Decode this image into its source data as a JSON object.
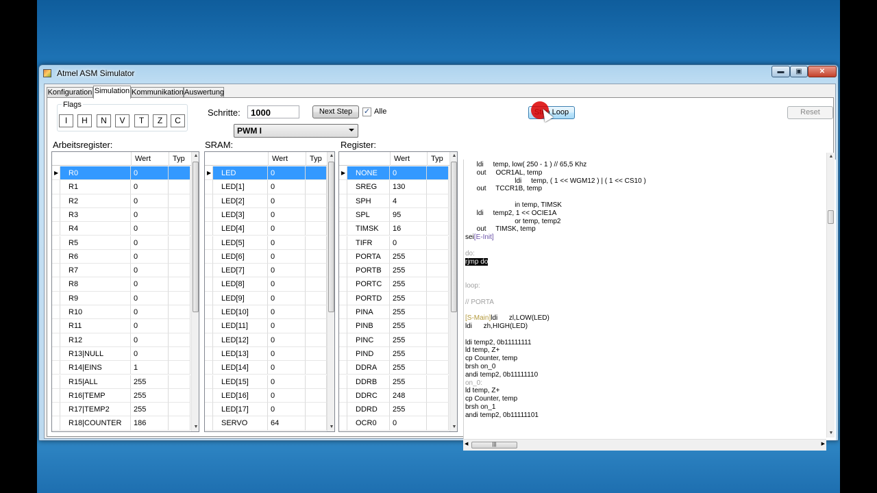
{
  "window": {
    "title": "Atmel ASM Simulator",
    "min": "▬",
    "max": "▣",
    "close": "✕"
  },
  "tabs": [
    "Konfiguration",
    "Simulation",
    "Kommunikation",
    "Auswertung"
  ],
  "flags": {
    "title": "Flags",
    "items": [
      "I",
      "H",
      "N",
      "V",
      "T",
      "Z",
      "C"
    ]
  },
  "steps": {
    "label": "Schritte:",
    "value": "1000"
  },
  "next_step": "Next Step",
  "alle": {
    "label": "Alle",
    "checked": true
  },
  "mode_combo": "PWM I",
  "stop_loop": "Stop Loop",
  "reset": "Reset",
  "arbeitsregister": {
    "title": "Arbeitsregister:",
    "headers": [
      "Wert",
      "Typ"
    ],
    "rows": [
      [
        "R0",
        "0"
      ],
      [
        "R1",
        "0"
      ],
      [
        "R2",
        "0"
      ],
      [
        "R3",
        "0"
      ],
      [
        "R4",
        "0"
      ],
      [
        "R5",
        "0"
      ],
      [
        "R6",
        "0"
      ],
      [
        "R7",
        "0"
      ],
      [
        "R8",
        "0"
      ],
      [
        "R9",
        "0"
      ],
      [
        "R10",
        "0"
      ],
      [
        "R11",
        "0"
      ],
      [
        "R12",
        "0"
      ],
      [
        "R13|NULL",
        "0"
      ],
      [
        "R14|EINS",
        "1"
      ],
      [
        "R15|ALL",
        "255"
      ],
      [
        "R16|TEMP",
        "255"
      ],
      [
        "R17|TEMP2",
        "255"
      ],
      [
        "R18|COUNTER",
        "186"
      ]
    ]
  },
  "sram": {
    "title": "SRAM:",
    "headers": [
      "Wert",
      "Typ"
    ],
    "rows": [
      [
        "LED",
        "0"
      ],
      [
        "LED[1]",
        "0"
      ],
      [
        "LED[2]",
        "0"
      ],
      [
        "LED[3]",
        "0"
      ],
      [
        "LED[4]",
        "0"
      ],
      [
        "LED[5]",
        "0"
      ],
      [
        "LED[6]",
        "0"
      ],
      [
        "LED[7]",
        "0"
      ],
      [
        "LED[8]",
        "0"
      ],
      [
        "LED[9]",
        "0"
      ],
      [
        "LED[10]",
        "0"
      ],
      [
        "LED[11]",
        "0"
      ],
      [
        "LED[12]",
        "0"
      ],
      [
        "LED[13]",
        "0"
      ],
      [
        "LED[14]",
        "0"
      ],
      [
        "LED[15]",
        "0"
      ],
      [
        "LED[16]",
        "0"
      ],
      [
        "LED[17]",
        "0"
      ],
      [
        "SERVO",
        "64"
      ]
    ]
  },
  "register": {
    "title": "Register:",
    "headers": [
      "Wert",
      "Typ"
    ],
    "rows": [
      [
        "NONE",
        "0"
      ],
      [
        "SREG",
        "130"
      ],
      [
        "SPH",
        "4"
      ],
      [
        "SPL",
        "95"
      ],
      [
        "TIMSK",
        "16"
      ],
      [
        "TIFR",
        "0"
      ],
      [
        "PORTA",
        "255"
      ],
      [
        "PORTB",
        "255"
      ],
      [
        "PORTC",
        "255"
      ],
      [
        "PORTD",
        "255"
      ],
      [
        "PINA",
        "255"
      ],
      [
        "PINB",
        "255"
      ],
      [
        "PINC",
        "255"
      ],
      [
        "PIND",
        "255"
      ],
      [
        "DDRA",
        "255"
      ],
      [
        "DDRB",
        "255"
      ],
      [
        "DDRC",
        "248"
      ],
      [
        "DDRD",
        "255"
      ],
      [
        "OCR0",
        "0"
      ]
    ]
  },
  "code": [
    {
      "text": "      ldi     temp, low( 250 - 1 ) // 65,5 Khz",
      "style": ""
    },
    {
      "text": "      out     OCR1AL, temp",
      "style": ""
    },
    {
      "text": "                          ldi     temp, ( 1 << WGM12 ) | ( 1 << CS10 )",
      "style": ""
    },
    {
      "text": "      out     TCCR1B, temp",
      "style": ""
    },
    {
      "text": "",
      "style": ""
    },
    {
      "text": "                          in temp, TIMSK",
      "style": ""
    },
    {
      "text": "      ldi     temp2, 1 << OCIE1A",
      "style": ""
    },
    {
      "text": "                          or temp, temp2",
      "style": ""
    },
    {
      "text": "      out     TIMSK, temp",
      "style": ""
    },
    {
      "text": "sei",
      "suffix": "[E-Init]",
      "style": "ob"
    },
    {
      "text": "",
      "style": ""
    },
    {
      "text": "do:",
      "style": "gray"
    },
    {
      "text": "rjmp do",
      "style": "dark"
    },
    {
      "text": "",
      "style": ""
    },
    {
      "text": "",
      "style": ""
    },
    {
      "text": "loop:",
      "style": "gray"
    },
    {
      "text": "",
      "style": ""
    },
    {
      "text": "// PORTA",
      "style": "gray"
    },
    {
      "text": "",
      "style": ""
    },
    {
      "text": "ldi      zl,LOW(LED)",
      "prefix": "[S-Main]",
      "style": "ol"
    },
    {
      "text": "ldi      zh,HIGH(LED)",
      "style": ""
    },
    {
      "text": "",
      "style": ""
    },
    {
      "text": "ldi temp2, 0b11111111",
      "style": ""
    },
    {
      "text": "ld temp, Z+",
      "style": ""
    },
    {
      "text": "cp Counter, temp",
      "style": ""
    },
    {
      "text": "brsh on_0",
      "style": ""
    },
    {
      "text": "andi temp2, 0b11111110",
      "style": ""
    },
    {
      "text": "on_0:",
      "style": "gray"
    },
    {
      "text": "ld temp, Z+",
      "style": ""
    },
    {
      "text": "cp Counter, temp",
      "style": ""
    },
    {
      "text": "brsh on_1",
      "style": ""
    },
    {
      "text": "andi temp2, 0b11111101",
      "style": ""
    }
  ]
}
